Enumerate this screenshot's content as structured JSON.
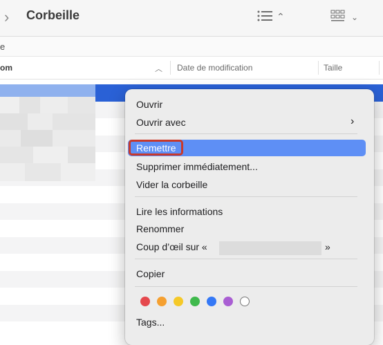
{
  "toolbar": {
    "title": "Corbeille",
    "back_icon": "chevron-right-icon",
    "list_icon": "list-view-icon",
    "grid_icon": "grid-view-icon"
  },
  "pathbar": {
    "text": "e"
  },
  "columns": {
    "name": "om",
    "date": "Date de modification",
    "size": "Taille"
  },
  "context_menu": {
    "items": {
      "open": "Ouvrir",
      "open_with": "Ouvrir avec",
      "put_back": "Remettre",
      "delete_now": "Supprimer immédiatement...",
      "empty_trash": "Vider la corbeille",
      "get_info": "Lire les informations",
      "rename": "Renommer",
      "quick_look_prefix": "Coup d’œil sur «",
      "quick_look_suffix": "»",
      "copy": "Copier",
      "tags": "Tags..."
    },
    "tag_colors": [
      "#e5484d",
      "#f5a030",
      "#f5c928",
      "#3fb94c",
      "#3478f6",
      "#a95ed3",
      "#ffffff"
    ]
  },
  "colors": {
    "selection": "#2a61d6",
    "menu_highlight": "#5e8ff5",
    "annotation": "#c8392b"
  }
}
